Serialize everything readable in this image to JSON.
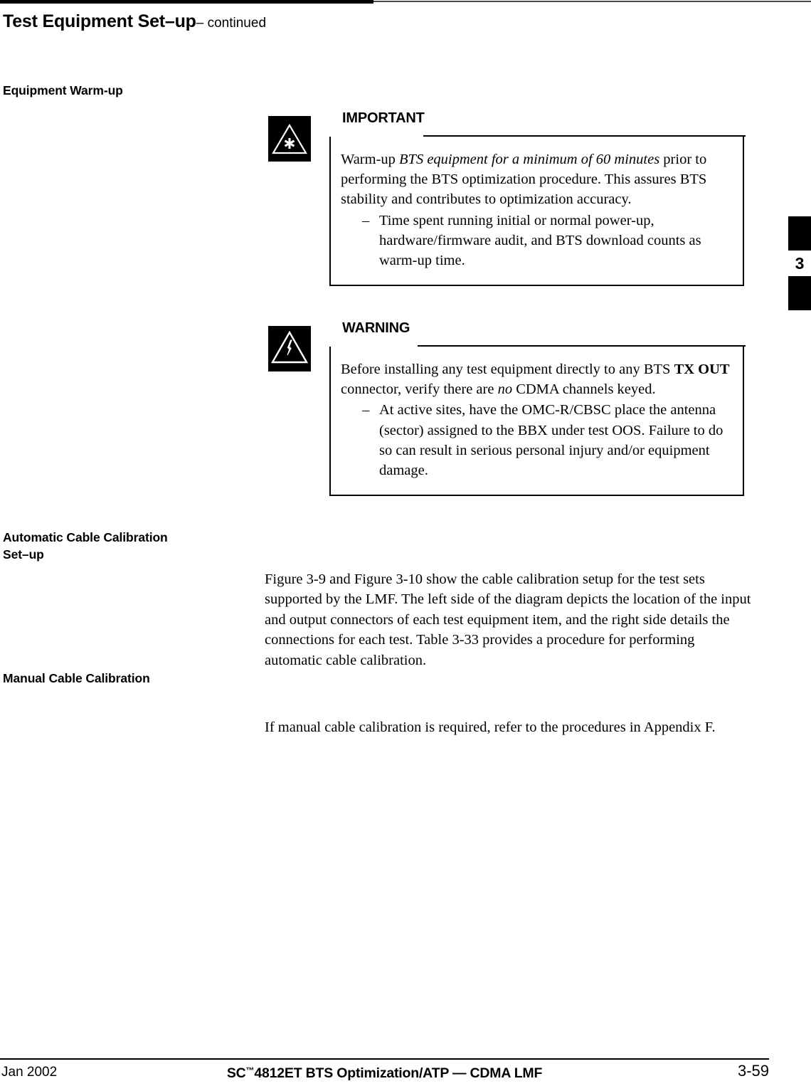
{
  "header": {
    "running_head_main": "Test Equipment Set–up",
    "running_head_continued": "– continued"
  },
  "tab": {
    "chapter_number": "3"
  },
  "headings": {
    "equipment_warmup": "Equipment Warm-up",
    "automatic_cable_calibration_setup": "Automatic Cable Calibration\nSet–up",
    "manual_cable_calibration": "Manual Cable Calibration"
  },
  "important": {
    "title": "IMPORTANT",
    "icon": "asterisk-triangle-icon",
    "para_lead": "Warm-up ",
    "para_italic": "BTS equipment for a minimum of 60 minutes",
    "para_tail": " prior to performing the BTS optimization procedure. This assures BTS stability and contributes to optimization accuracy.",
    "dash_mark": "–",
    "dash_text": "Time spent running initial or normal power-up, hardware/firmware audit, and BTS download counts as warm-up time."
  },
  "warning": {
    "title": "WARNING",
    "icon": "lightning-triangle-icon",
    "para_lead": "Before installing any test equipment directly to any BTS ",
    "para_bold": "TX OUT",
    "para_mid": " connector, verify there are ",
    "para_italic": "no",
    "para_tail": " CDMA channels keyed.",
    "dash_mark": "–",
    "dash_text": "At active sites, have the OMC-R/CBSC place the antenna (sector) assigned to the BBX under test OOS. Failure to do so can result in serious personal injury and/or equipment damage."
  },
  "body": {
    "automatic_cable_calibration": "Figure 3-9 and Figure 3-10 show the cable calibration setup for the test sets supported by the LMF. The left side of the diagram depicts the location of the input and output connectors of each test equipment item, and the right side details the connections for each test. Table 3-33 provides a procedure for performing automatic cable calibration.",
    "manual_cable_calibration": "If manual cable calibration is required, refer to the procedures in Appendix F."
  },
  "footer": {
    "date": "Jan 2002",
    "title_prefix": "SC",
    "title_tm": "™",
    "title_rest": "4812ET BTS Optimization/ATP — CDMA LMF",
    "page_number": "3-59"
  }
}
